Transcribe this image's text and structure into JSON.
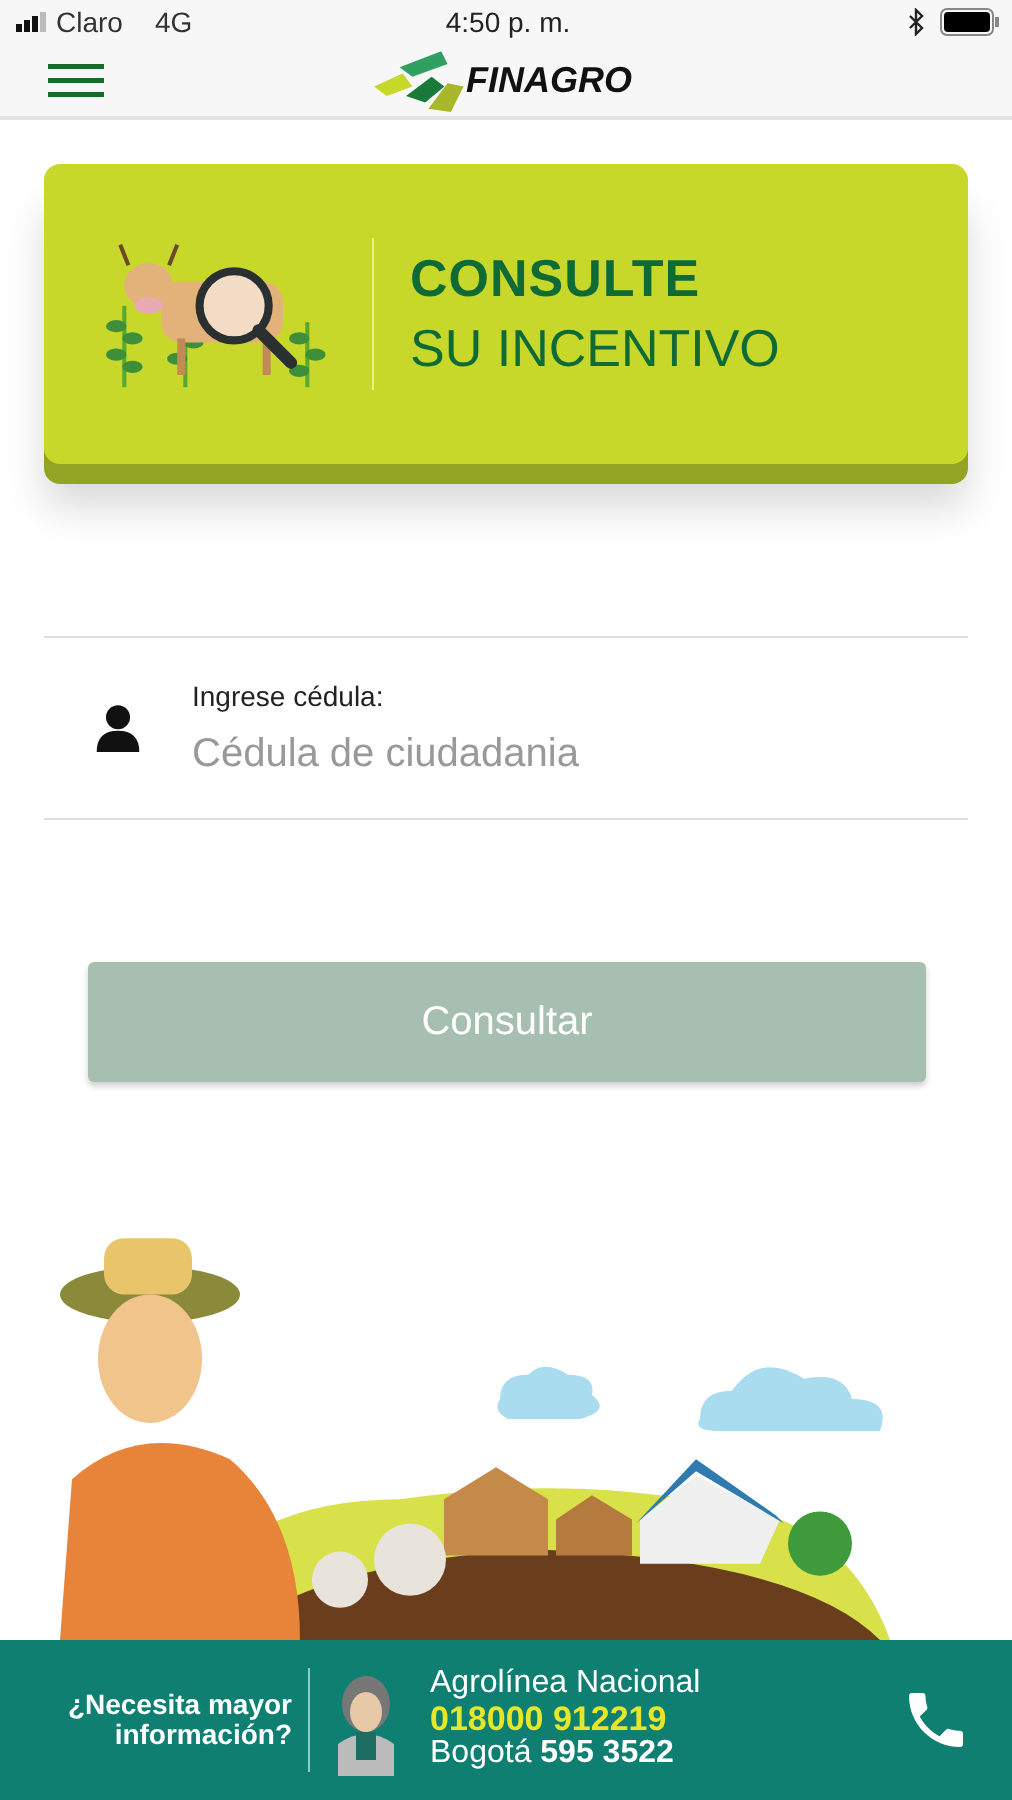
{
  "status_bar": {
    "carrier": "Claro",
    "network": "4G",
    "time": "4:50 p. m."
  },
  "header": {
    "logo_text": "FINAGRO"
  },
  "banner": {
    "title": "CONSULTE",
    "subtitle": "SU INCENTIVO"
  },
  "form": {
    "label": "Ingrese cédula:",
    "placeholder": "Cédula de ciudadania"
  },
  "submit": {
    "label": "Consultar",
    "disabled": true
  },
  "footer": {
    "question": "¿Necesita mayor información?",
    "line_name": "Agrolínea Nacional",
    "toll_free": "018000 912219",
    "local": "Bogotá **595 3522**"
  }
}
